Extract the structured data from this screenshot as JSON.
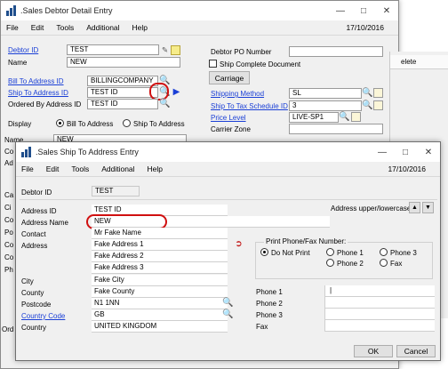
{
  "debtor_window": {
    "title": ".Sales Debtor Detail Entry",
    "menu": [
      "File",
      "Edit",
      "Tools",
      "Additional",
      "Help"
    ],
    "date": "17/10/2016",
    "labels": {
      "debtor_id": "Debtor ID",
      "name": "Name",
      "bill_to": "Bill To Address ID",
      "ship_to": "Ship To Address ID",
      "ordered_by": "Ordered By Address ID",
      "display": "Display",
      "name2": "Name",
      "debtor_po": "Debtor PO Number",
      "ship_complete": "Ship Complete Document",
      "shipping_method": "Shipping Method",
      "tax_schedule": "Ship To Tax Schedule ID",
      "price_level": "Price Level",
      "carrier_zone": "Carrier Zone",
      "side_fragment": "elete"
    },
    "values": {
      "debtor_id": "TEST",
      "name": "NEW",
      "bill_to": "BILLINGCOMPANY",
      "ship_to": "TEST ID",
      "ordered_by": "TEST ID",
      "name2": "NEW",
      "debtor_po": "",
      "shipping_method": "SL",
      "tax_schedule": "3",
      "price_level": "LIVE-SP1",
      "carrier_zone": ""
    },
    "carriage_button": "Carriage",
    "display_options": [
      "Bill To Address",
      "Ship To Address"
    ],
    "left_fragments": [
      "Co",
      "Ad",
      "Ca",
      "Ci",
      "Co",
      "Po",
      "Co",
      "Co",
      "Ph",
      "Ord"
    ]
  },
  "ship_window": {
    "title": ".Sales Ship To Address Entry",
    "menu": [
      "File",
      "Edit",
      "Tools",
      "Additional",
      "Help"
    ],
    "date": "17/10/2016",
    "labels": {
      "debtor_id": "Debtor ID",
      "address_id": "Address ID",
      "address_name": "Address Name",
      "contact": "Contact",
      "address": "Address",
      "city": "City",
      "county": "County",
      "postcode": "Postcode",
      "country_code": "Country Code",
      "country": "Country",
      "address_case": "Address upper/lowercase:",
      "print_phone": "Print Phone/Fax Number:",
      "phone1": "Phone 1",
      "phone2": "Phone 2",
      "phone3": "Phone 3",
      "fax": "Fax"
    },
    "values": {
      "debtor_id": "TEST",
      "address_id": "TEST ID",
      "address_name": "NEW",
      "contact": "Mr Fake Name",
      "address1": "Fake Address 1",
      "address2": "Fake Address 2",
      "address3": "Fake Address 3",
      "city": "Fake City",
      "county": "Fake County",
      "postcode": "N1 1NN",
      "country_code": "GB",
      "country": "UNITED KINGDOM",
      "phone1": "",
      "phone2": "",
      "phone3": "",
      "fax": ""
    },
    "print_options": {
      "do_not_print": "Do Not Print",
      "phone1": "Phone 1",
      "phone2": "Phone 2",
      "phone3": "Phone 3",
      "fax": "Fax",
      "selected": "Do Not Print"
    },
    "ok_button": "OK",
    "cancel_button": "Cancel"
  }
}
